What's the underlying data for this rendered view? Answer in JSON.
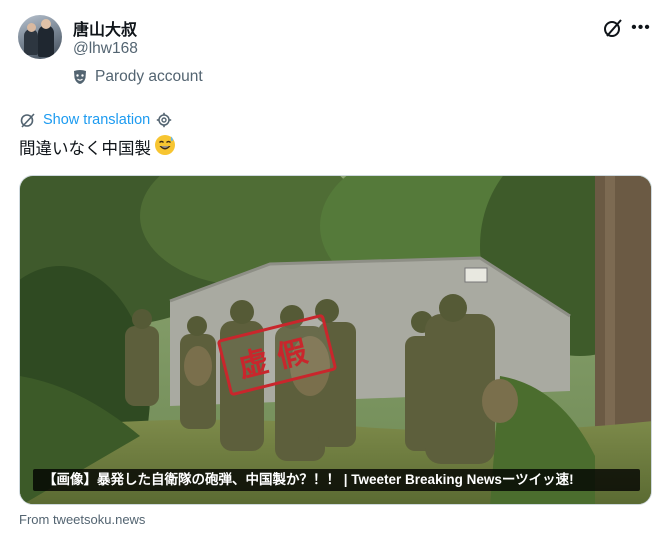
{
  "author": {
    "display_name": "唐山大叔",
    "handle": "@lhw168",
    "badge_label": "Parody account"
  },
  "tweet": {
    "translate_label": "Show translation",
    "text": "間違いなく中国製",
    "emoji": "😅"
  },
  "media": {
    "stamp_text": "虚假",
    "caption": "【画像】暴発した自衛隊の砲弾、中国製か？！！ | Tweeter Breaking Newsーツイッ速!"
  },
  "source": "From tweetsoku.news",
  "colors": {
    "link": "#1d9bf0",
    "secondary_text": "#536471",
    "stamp_red": "#c9262c"
  },
  "icons": [
    "grok-icon",
    "more-icon",
    "parody-mask-icon",
    "translate-icon",
    "settings-gear-icon"
  ]
}
